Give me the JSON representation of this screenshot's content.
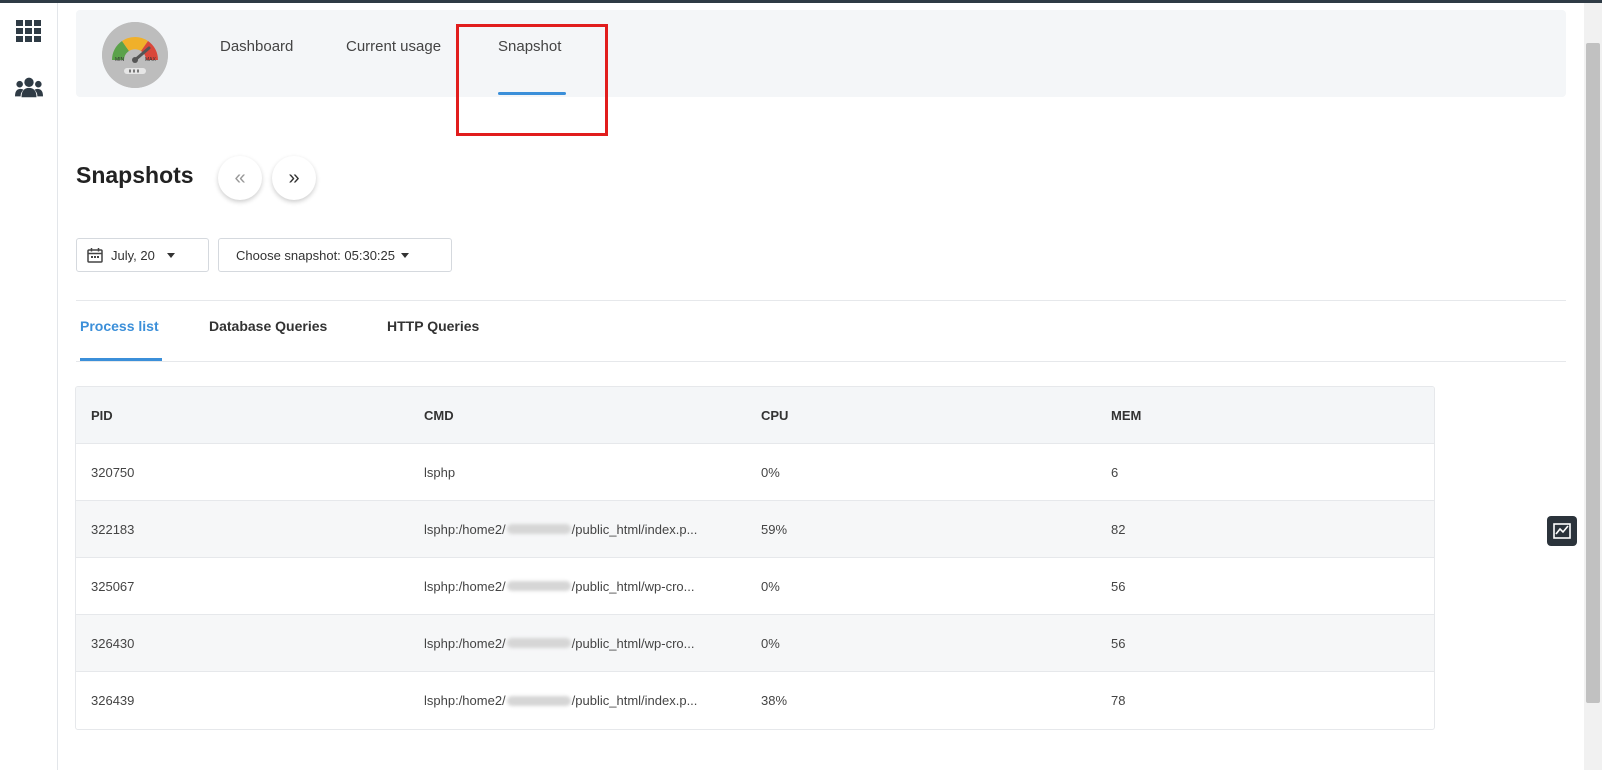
{
  "header": {
    "nav": [
      {
        "label": "Dashboard"
      },
      {
        "label": "Current usage"
      },
      {
        "label": "Snapshot"
      }
    ],
    "logo_min": "MIN",
    "logo_max": "MAX"
  },
  "page": {
    "title": "Snapshots",
    "prev_glyph": "«",
    "next_glyph": "»"
  },
  "filters": {
    "date_label": "July, 20",
    "snapshot_label": "Choose snapshot: 05:30:25"
  },
  "subtabs": [
    {
      "label": "Process list"
    },
    {
      "label": "Database Queries"
    },
    {
      "label": "HTTP Queries"
    }
  ],
  "table": {
    "headers": [
      "PID",
      "CMD",
      "CPU",
      "MEM"
    ],
    "rows": [
      {
        "pid": "320750",
        "cmd_prefix": "lsphp",
        "cmd_suffix": "",
        "cpu": "0%",
        "mem": "6"
      },
      {
        "pid": "322183",
        "cmd_prefix": "lsphp:/home2/",
        "cmd_suffix": "/public_html/index.p...",
        "cpu": "59%",
        "mem": "82"
      },
      {
        "pid": "325067",
        "cmd_prefix": "lsphp:/home2/",
        "cmd_suffix": "/public_html/wp-cro...",
        "cpu": "0%",
        "mem": "56"
      },
      {
        "pid": "326430",
        "cmd_prefix": "lsphp:/home2/",
        "cmd_suffix": "/public_html/wp-cro...",
        "cpu": "0%",
        "mem": "56"
      },
      {
        "pid": "326439",
        "cmd_prefix": "lsphp:/home2/",
        "cmd_suffix": "/public_html/index.p...",
        "cpu": "38%",
        "mem": "78"
      }
    ]
  },
  "colors": {
    "accent": "#3b8fd9",
    "highlight": "#e11d1d",
    "dark": "#2b333b"
  },
  "icons": {
    "left_top": "grid-icon",
    "left_second": "users-icon",
    "calendar": "calendar-icon",
    "side": "chart-icon"
  }
}
